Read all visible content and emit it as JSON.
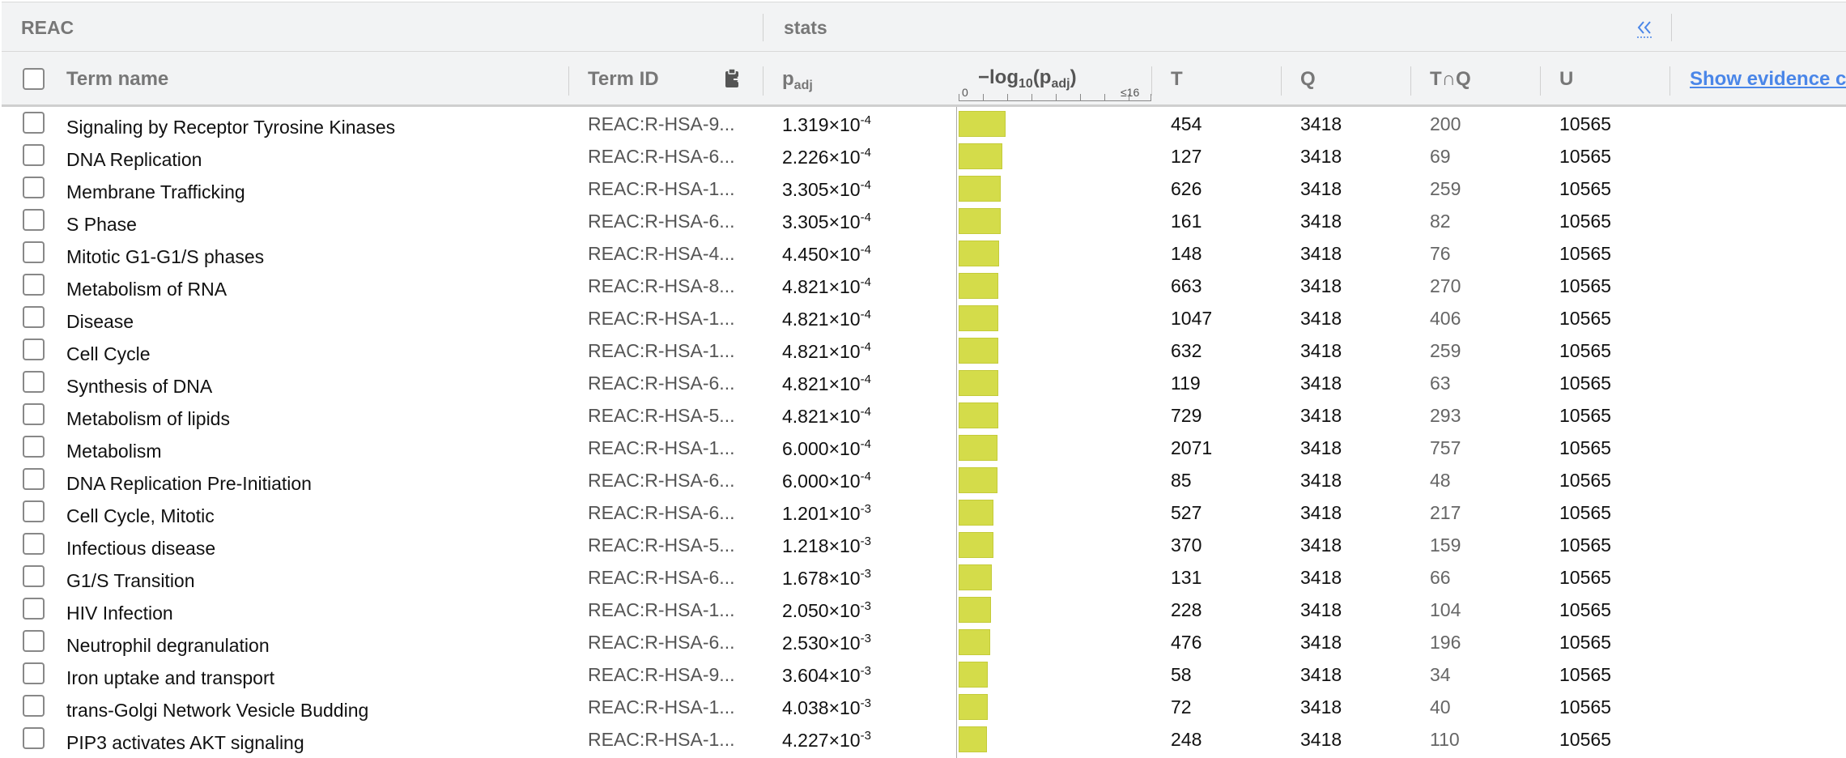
{
  "group_header": {
    "source": "REAC",
    "stats": "stats"
  },
  "columns": {
    "term_name": "Term name",
    "term_id": "Term ID",
    "padj_main": "p",
    "padj_sub": "adj",
    "scale_title_main": "−log",
    "scale_title_sub1": "10",
    "scale_title_p": "(p",
    "scale_title_sub2": "adj",
    "scale_title_close": ")",
    "scale_min": "0",
    "scale_max": "≤16",
    "t": "T",
    "q": "Q",
    "tq": "T∩Q",
    "u": "U",
    "show_evidence": "Show evidence c"
  },
  "colors": {
    "bar": "#d4dc4a",
    "link": "#4a86e8",
    "header_bg": "#f2f3f4"
  },
  "scale": {
    "max_value": 16
  },
  "rows": [
    {
      "name": "Signaling by Receptor Tyrosine Kinases",
      "id": "REAC:R-HSA-9...",
      "mant": "1.319",
      "exp": "-4",
      "neglog": 3.88,
      "t": "454",
      "q": "3418",
      "tq": "200",
      "u": "10565"
    },
    {
      "name": "DNA Replication",
      "id": "REAC:R-HSA-6...",
      "mant": "2.226",
      "exp": "-4",
      "neglog": 3.65,
      "t": "127",
      "q": "3418",
      "tq": "69",
      "u": "10565"
    },
    {
      "name": "Membrane Trafficking",
      "id": "REAC:R-HSA-1...",
      "mant": "3.305",
      "exp": "-4",
      "neglog": 3.48,
      "t": "626",
      "q": "3418",
      "tq": "259",
      "u": "10565"
    },
    {
      "name": "S Phase",
      "id": "REAC:R-HSA-6...",
      "mant": "3.305",
      "exp": "-4",
      "neglog": 3.48,
      "t": "161",
      "q": "3418",
      "tq": "82",
      "u": "10565"
    },
    {
      "name": "Mitotic G1-G1/S phases",
      "id": "REAC:R-HSA-4...",
      "mant": "4.450",
      "exp": "-4",
      "neglog": 3.35,
      "t": "148",
      "q": "3418",
      "tq": "76",
      "u": "10565"
    },
    {
      "name": "Metabolism of RNA",
      "id": "REAC:R-HSA-8...",
      "mant": "4.821",
      "exp": "-4",
      "neglog": 3.32,
      "t": "663",
      "q": "3418",
      "tq": "270",
      "u": "10565"
    },
    {
      "name": "Disease",
      "id": "REAC:R-HSA-1...",
      "mant": "4.821",
      "exp": "-4",
      "neglog": 3.32,
      "t": "1047",
      "q": "3418",
      "tq": "406",
      "u": "10565"
    },
    {
      "name": "Cell Cycle",
      "id": "REAC:R-HSA-1...",
      "mant": "4.821",
      "exp": "-4",
      "neglog": 3.32,
      "t": "632",
      "q": "3418",
      "tq": "259",
      "u": "10565"
    },
    {
      "name": "Synthesis of DNA",
      "id": "REAC:R-HSA-6...",
      "mant": "4.821",
      "exp": "-4",
      "neglog": 3.32,
      "t": "119",
      "q": "3418",
      "tq": "63",
      "u": "10565"
    },
    {
      "name": "Metabolism of lipids",
      "id": "REAC:R-HSA-5...",
      "mant": "4.821",
      "exp": "-4",
      "neglog": 3.32,
      "t": "729",
      "q": "3418",
      "tq": "293",
      "u": "10565"
    },
    {
      "name": "Metabolism",
      "id": "REAC:R-HSA-1...",
      "mant": "6.000",
      "exp": "-4",
      "neglog": 3.22,
      "t": "2071",
      "q": "3418",
      "tq": "757",
      "u": "10565"
    },
    {
      "name": "DNA Replication Pre-Initiation",
      "id": "REAC:R-HSA-6...",
      "mant": "6.000",
      "exp": "-4",
      "neglog": 3.22,
      "t": "85",
      "q": "3418",
      "tq": "48",
      "u": "10565"
    },
    {
      "name": "Cell Cycle, Mitotic",
      "id": "REAC:R-HSA-6...",
      "mant": "1.201",
      "exp": "-3",
      "neglog": 2.92,
      "t": "527",
      "q": "3418",
      "tq": "217",
      "u": "10565"
    },
    {
      "name": "Infectious disease",
      "id": "REAC:R-HSA-5...",
      "mant": "1.218",
      "exp": "-3",
      "neglog": 2.91,
      "t": "370",
      "q": "3418",
      "tq": "159",
      "u": "10565"
    },
    {
      "name": "G1/S Transition",
      "id": "REAC:R-HSA-6...",
      "mant": "1.678",
      "exp": "-3",
      "neglog": 2.78,
      "t": "131",
      "q": "3418",
      "tq": "66",
      "u": "10565"
    },
    {
      "name": "HIV Infection",
      "id": "REAC:R-HSA-1...",
      "mant": "2.050",
      "exp": "-3",
      "neglog": 2.69,
      "t": "228",
      "q": "3418",
      "tq": "104",
      "u": "10565"
    },
    {
      "name": "Neutrophil degranulation",
      "id": "REAC:R-HSA-6...",
      "mant": "2.530",
      "exp": "-3",
      "neglog": 2.6,
      "t": "476",
      "q": "3418",
      "tq": "196",
      "u": "10565"
    },
    {
      "name": "Iron uptake and transport",
      "id": "REAC:R-HSA-9...",
      "mant": "3.604",
      "exp": "-3",
      "neglog": 2.44,
      "t": "58",
      "q": "3418",
      "tq": "34",
      "u": "10565"
    },
    {
      "name": "trans-Golgi Network Vesicle Budding",
      "id": "REAC:R-HSA-1...",
      "mant": "4.038",
      "exp": "-3",
      "neglog": 2.39,
      "t": "72",
      "q": "3418",
      "tq": "40",
      "u": "10565"
    },
    {
      "name": "PIP3 activates AKT signaling",
      "id": "REAC:R-HSA-1...",
      "mant": "4.227",
      "exp": "-3",
      "neglog": 2.37,
      "t": "248",
      "q": "3418",
      "tq": "110",
      "u": "10565"
    }
  ]
}
